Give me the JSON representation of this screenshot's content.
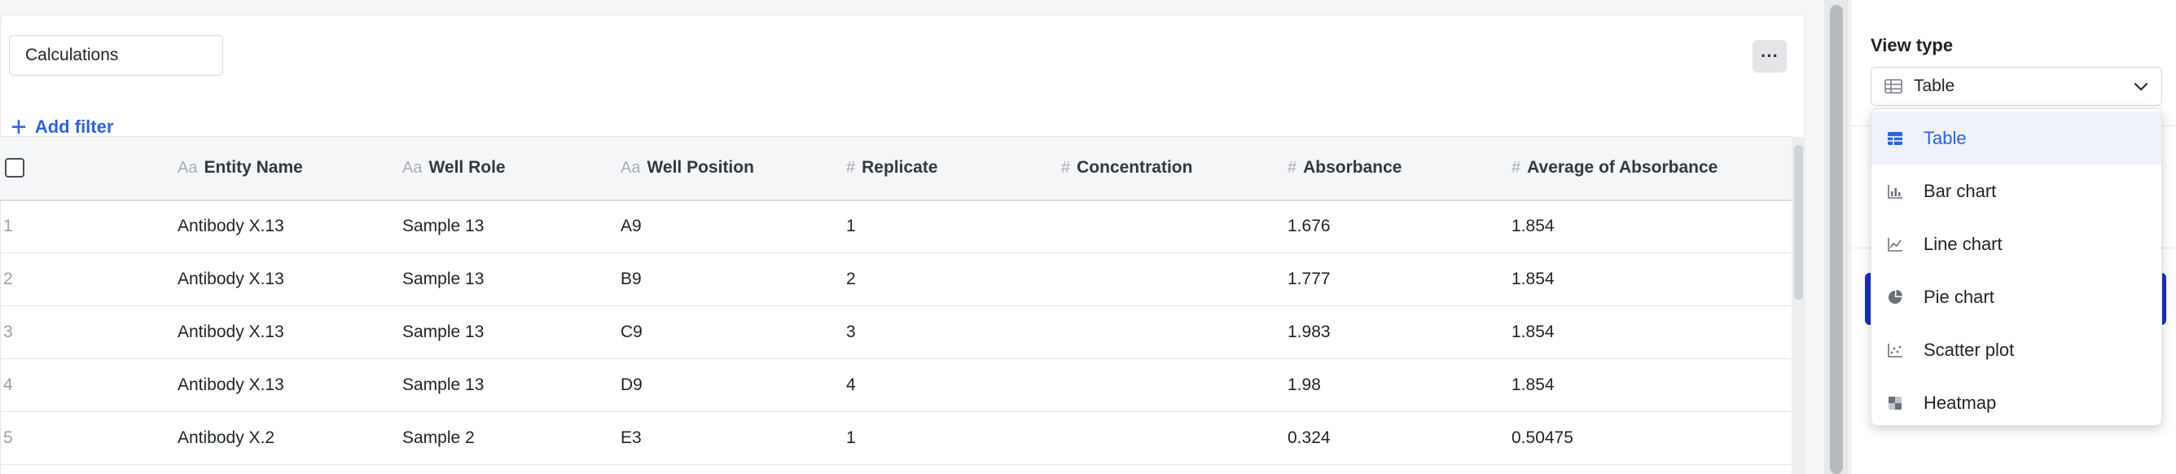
{
  "toolbar": {
    "calculations_value": "Calculations",
    "more_label": "···",
    "add_filter_icon": "+",
    "add_filter_label": "Add filter"
  },
  "table": {
    "columns": [
      {
        "type_icon": "Aa",
        "label": "Entity Name"
      },
      {
        "type_icon": "Aa",
        "label": "Well Role"
      },
      {
        "type_icon": "Aa",
        "label": "Well Position"
      },
      {
        "type_icon": "#",
        "label": "Replicate"
      },
      {
        "type_icon": "#",
        "label": "Concentration"
      },
      {
        "type_icon": "#",
        "label": "Absorbance"
      },
      {
        "type_icon": "#",
        "label": "Average of Absorbance"
      }
    ],
    "rows": [
      {
        "num": "1",
        "entity": "Antibody X.13",
        "role": "Sample 13",
        "position": "A9",
        "replicate": "1",
        "concentration": "",
        "absorbance": "1.676",
        "avg": "1.854"
      },
      {
        "num": "2",
        "entity": "Antibody X.13",
        "role": "Sample 13",
        "position": "B9",
        "replicate": "2",
        "concentration": "",
        "absorbance": "1.777",
        "avg": "1.854"
      },
      {
        "num": "3",
        "entity": "Antibody X.13",
        "role": "Sample 13",
        "position": "C9",
        "replicate": "3",
        "concentration": "",
        "absorbance": "1.983",
        "avg": "1.854"
      },
      {
        "num": "4",
        "entity": "Antibody X.13",
        "role": "Sample 13",
        "position": "D9",
        "replicate": "4",
        "concentration": "",
        "absorbance": "1.98",
        "avg": "1.854"
      },
      {
        "num": "5",
        "entity": "Antibody X.2",
        "role": "Sample 2",
        "position": "E3",
        "replicate": "1",
        "concentration": "",
        "absorbance": "0.324",
        "avg": "0.50475"
      }
    ]
  },
  "view_panel": {
    "label": "View type",
    "selected": "Table",
    "options": [
      {
        "label": "Table",
        "icon": "table-icon"
      },
      {
        "label": "Bar chart",
        "icon": "bar-chart-icon"
      },
      {
        "label": "Line chart",
        "icon": "line-chart-icon"
      },
      {
        "label": "Pie chart",
        "icon": "pie-chart-icon"
      },
      {
        "label": "Scatter plot",
        "icon": "scatter-plot-icon"
      },
      {
        "label": "Heatmap",
        "icon": "heatmap-icon"
      }
    ]
  },
  "colors": {
    "accent": "#2b64d8",
    "primary_button": "#1730c7",
    "selected_bg": "#eef2fb"
  }
}
